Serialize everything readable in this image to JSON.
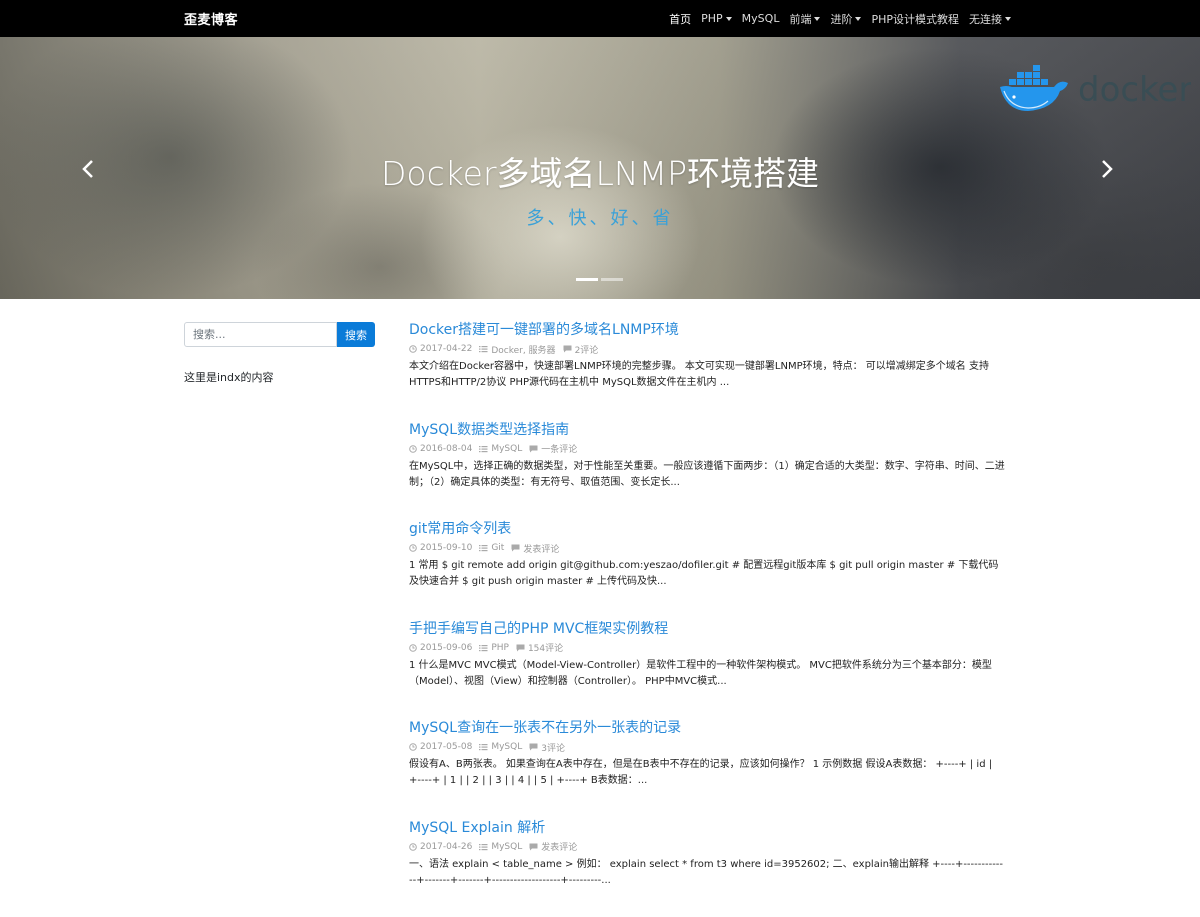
{
  "navbar": {
    "brand": "歪麦博客",
    "items": [
      {
        "label": "首页",
        "dropdown": false,
        "active": true
      },
      {
        "label": "PHP",
        "dropdown": true
      },
      {
        "label": "MySQL",
        "dropdown": false
      },
      {
        "label": "前端",
        "dropdown": true
      },
      {
        "label": "进阶",
        "dropdown": true
      },
      {
        "label": "PHP设计模式教程",
        "dropdown": false
      },
      {
        "label": "无连接",
        "dropdown": true
      }
    ]
  },
  "carousel": {
    "title": "Docker多域名LNMP环境搭建",
    "subtitle": "多、快、好、省",
    "logo_text": "docker",
    "slide_count": 2,
    "active_slide": 1
  },
  "sidebar": {
    "search_placeholder": "搜索...",
    "search_button": "搜索",
    "text": "这里是indx的内容"
  },
  "posts": [
    {
      "title": "Docker搭建可一键部署的多域名LNMP环境",
      "date": "2017-04-22",
      "category": "Docker, 服务器",
      "comments": "2评论",
      "excerpt": "本文介绍在Docker容器中，快速部署LNMP环境的完整步骤。 本文可实现一键部署LNMP环境，特点： 可以增减绑定多个域名 支持HTTPS和HTTP/2协议 PHP源代码在主机中 MySQL数据文件在主机内 ..."
    },
    {
      "title": "MySQL数据类型选择指南",
      "date": "2016-08-04",
      "category": "MySQL",
      "comments": "一条评论",
      "excerpt": "在MySQL中，选择正确的数据类型，对于性能至关重要。一般应该遵循下面两步：（1）确定合适的大类型：数字、字符串、时间、二进制；（2）确定具体的类型：有无符号、取值范围、变长定长..."
    },
    {
      "title": "git常用命令列表",
      "date": "2015-09-10",
      "category": "Git",
      "comments": "发表评论",
      "excerpt": "1 常用 $ git remote add origin git@github.com:yeszao/dofiler.git # 配置远程git版本库 $ git pull origin master # 下载代码及快速合并 $ git push origin master # 上传代码及快..."
    },
    {
      "title": "手把手编写自己的PHP MVC框架实例教程",
      "date": "2015-09-06",
      "category": "PHP",
      "comments": "154评论",
      "excerpt": "1 什么是MVC MVC模式（Model-View-Controller）是软件工程中的一种软件架构模式。 MVC把软件系统分为三个基本部分：模型（Model）、视图（View）和控制器（Controller）。 PHP中MVC模式..."
    },
    {
      "title": "MySQL查询在一张表不在另外一张表的记录",
      "date": "2017-05-08",
      "category": "MySQL",
      "comments": "3评论",
      "excerpt": "假设有A、B两张表。 如果查询在A表中存在，但是在B表中不存在的记录，应该如何操作？ 1 示例数据 假设A表数据： +----+ | id | +----+ | 1 | | 2 | | 3 | | 4 | | 5 | +----+ B表数据：..."
    },
    {
      "title": "MySQL Explain 解析",
      "date": "2017-04-26",
      "category": "MySQL",
      "comments": "发表评论",
      "excerpt": "一、语法 explain < table_name > 例如： explain select * from t3 where id=3952602; 二、explain输出解释 +----+-------------+-------+-------+-------------------+---------..."
    }
  ],
  "colors": {
    "navbar_bg": "#000000",
    "link": "#2a8ad8",
    "subtitle": "#3aa1d8",
    "button": "#0a7bd8"
  }
}
